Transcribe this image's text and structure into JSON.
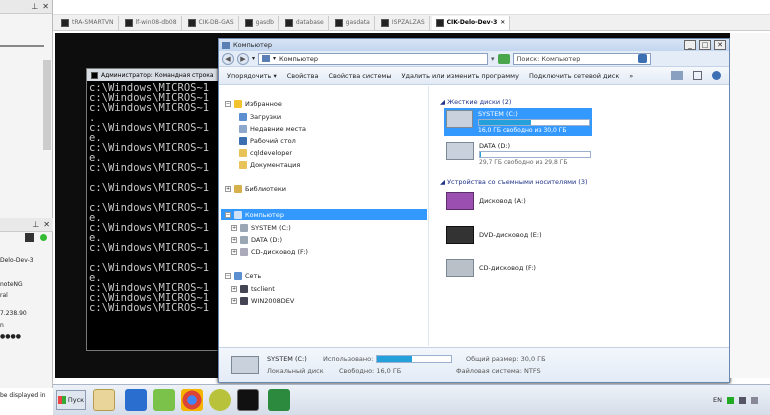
{
  "host": {
    "left_panel_text": [
      "Delo-Dev-3",
      "noteNG",
      "ral",
      "7.238.90",
      "n",
      "●●●●",
      "be displayed in"
    ],
    "pin_glyph": "⊥",
    "close_glyph": "✕"
  },
  "tabs": [
    {
      "label": "tRA-SMARTVN",
      "active": false
    },
    {
      "label": "lf-win08-db08",
      "active": false
    },
    {
      "label": "CIK-DB-GAS",
      "active": false
    },
    {
      "label": "gasdb",
      "active": false
    },
    {
      "label": "database",
      "active": false
    },
    {
      "label": "gasdata",
      "active": false
    },
    {
      "label": "ISPZALZAS",
      "active": false
    },
    {
      "label": "CIK-Delo-Dev-3",
      "active": true
    }
  ],
  "cmd": {
    "title": "Администратор: Командная строка",
    "lines": [
      "c:\\Windows\\MICROS~1",
      "c:\\Windows\\MICROS~1",
      "c:\\Windows\\MICROS~1",
      ".",
      "c:\\Windows\\MICROS~1",
      "e.",
      "c:\\Windows\\MICROS~1",
      "e.",
      "c:\\Windows\\MICROS~1",
      "",
      "c:\\Windows\\MICROS~1",
      "",
      "c:\\Windows\\MICROS~1",
      "e.",
      "c:\\Windows\\MICROS~1",
      "e.",
      "c:\\Windows\\MICROS~1",
      "",
      "c:\\Windows\\MICROS~1",
      "e.",
      "c:\\Windows\\MICROS~1",
      "c:\\Windows\\MICROS~1",
      "c:\\Windows\\MICROS~1"
    ]
  },
  "explorer": {
    "title": "Компьютер",
    "address": "Компьютер",
    "search_placeholder": "Поиск: Компьютер",
    "toolbar": [
      "Упорядочить ▾",
      "Свойства",
      "Свойства системы",
      "Удалить или изменить программу",
      "Подключить сетевой диск",
      "»"
    ],
    "nav": {
      "favorites": "Избранное",
      "downloads": "Загрузки",
      "recent": "Недавние места",
      "desktop": "Рабочий стол",
      "cqldeveloper": "cqldeveloper",
      "documents": "Документация",
      "libraries": "Библиотеки",
      "computer": "Компьютер",
      "system_c": "SYSTEM (C:)",
      "data_d": "DATA (D:)",
      "cd_f": "CD-дисковод (F:)",
      "network": "Сеть",
      "tsclient": "tsclient",
      "win2008": "WIN2008DEV"
    },
    "groups": {
      "hdd": "Жесткие диски (2)",
      "removable": "Устройства со съемными носителями (3)"
    },
    "drives": [
      {
        "name": "SYSTEM (C:)",
        "free": "16,0 ГБ свободно из 30,0 ГБ",
        "used_fraction": 0.47,
        "selected": true
      },
      {
        "name": "DATA (D:)",
        "free": "29,7 ГБ свободно из 29,8 ГБ",
        "used_fraction": 0.01,
        "selected": false
      }
    ],
    "removable": [
      {
        "name": "Дисковод (A:)"
      },
      {
        "name": "DVD-дисковод (E:)"
      },
      {
        "name": "CD-дисковод (F:)"
      }
    ],
    "status": {
      "name": "SYSTEM (C:)",
      "type": "Локальный диск",
      "used_label": "Использовано:",
      "used_fraction": 0.47,
      "free_label": "Свободно: 16,0 ГБ",
      "total": "Общий размер: 30,0 ГБ",
      "fs": "Файловая система: NTFS"
    }
  },
  "taskbar": {
    "start_label": "Пуск",
    "lang": "EN"
  },
  "colors": {
    "selection": "#3399ff",
    "bar_fill": "#26a0da",
    "group_text": "#1e3287"
  }
}
